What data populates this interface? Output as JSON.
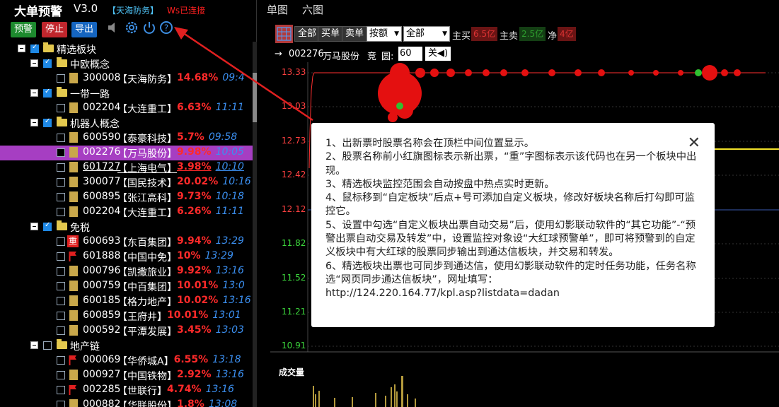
{
  "app": {
    "title": "大单预警",
    "version": "V3.0",
    "tag": "【天海防务】",
    "ws_status": "Ws已连接"
  },
  "toolbar_left": {
    "alert": "预警",
    "stop": "停止",
    "export": "导出"
  },
  "icons": [
    "speaker-icon",
    "gear-icon",
    "power-icon",
    "help-icon"
  ],
  "tree": {
    "root": "精选板块",
    "rows": [
      {
        "kind": "group",
        "level": 1,
        "label": "中欧概念",
        "checked": true
      },
      {
        "kind": "stock",
        "code": "300008",
        "name": "【天海防务】",
        "pct": "14.68%",
        "time": "09:4",
        "icon": "doc"
      },
      {
        "kind": "group",
        "level": 1,
        "label": "一带一路",
        "checked": true
      },
      {
        "kind": "stock",
        "code": "002204",
        "name": "【大连重工】",
        "pct": "6.63%",
        "time": "11:11",
        "icon": "doc"
      },
      {
        "kind": "group",
        "level": 1,
        "label": "机器人概念",
        "checked": true
      },
      {
        "kind": "stock",
        "code": "600590",
        "name": "【泰豪科技】",
        "pct": "5.7%",
        "time": "09:58",
        "icon": "doc"
      },
      {
        "kind": "stock",
        "code": "002276",
        "name": "【万马股份】",
        "pct": "9.98%",
        "time": "10:05",
        "icon": "doc",
        "selected": true
      },
      {
        "kind": "stock",
        "code": "601727",
        "name": "【上海电气】",
        "pct": "3.98%",
        "time": "10:10",
        "icon": "doc",
        "underline": true
      },
      {
        "kind": "stock",
        "code": "300077",
        "name": "【国民技术】",
        "pct": "20.02%",
        "time": "10:16",
        "icon": "doc"
      },
      {
        "kind": "stock",
        "code": "600895",
        "name": "【张江高科】",
        "pct": "9.73%",
        "time": "10:18",
        "icon": "doc"
      },
      {
        "kind": "stock",
        "code": "002204",
        "name": "【大连重工】",
        "pct": "6.26%",
        "time": "11:11",
        "icon": "doc"
      },
      {
        "kind": "group",
        "level": 1,
        "label": "免税",
        "checked": true
      },
      {
        "kind": "stock",
        "code": "600693",
        "name": "【东百集团】",
        "pct": "9.94%",
        "time": "13:29",
        "icon": "zhong"
      },
      {
        "kind": "stock",
        "code": "601888",
        "name": "【中国中免】",
        "pct": "10%",
        "time": "13:29",
        "icon": "flag"
      },
      {
        "kind": "stock",
        "code": "000796",
        "name": "【凯撒旅业】",
        "pct": "9.92%",
        "time": "13:16",
        "icon": "doc"
      },
      {
        "kind": "stock",
        "code": "000759",
        "name": "【中百集团】",
        "pct": "10.01%",
        "time": "13:0",
        "icon": "doc"
      },
      {
        "kind": "stock",
        "code": "600185",
        "name": "【格力地产】",
        "pct": "10.02%",
        "time": "13:16",
        "icon": "doc"
      },
      {
        "kind": "stock",
        "code": "600859",
        "name": "【王府井】",
        "pct": "10.01%",
        "time": "13:01",
        "icon": "doc"
      },
      {
        "kind": "stock",
        "code": "000592",
        "name": "【平潭发展】",
        "pct": "3.45%",
        "time": "13:03",
        "icon": "doc"
      },
      {
        "kind": "group",
        "level": 1,
        "label": "地产链",
        "checked": false
      },
      {
        "kind": "stock",
        "code": "000069",
        "name": "【华侨城A】",
        "pct": "6.55%",
        "time": "13:18",
        "icon": "flag"
      },
      {
        "kind": "stock",
        "code": "000927",
        "name": "【中国铁物】",
        "pct": "2.92%",
        "time": "13:16",
        "icon": "doc"
      },
      {
        "kind": "stock",
        "code": "002285",
        "name": "【世联行】",
        "pct": "4.74%",
        "time": "13:16",
        "icon": "flag"
      },
      {
        "kind": "stock",
        "code": "000882",
        "name": "【华联股份】",
        "pct": "1.8%",
        "time": "13:08",
        "icon": "doc"
      }
    ]
  },
  "tabs": {
    "single": "单图",
    "six": "六图"
  },
  "chart_toolbar": {
    "all1": "全部",
    "buy": "买单",
    "sell": "卖单",
    "sort": "按额",
    "filter": "全部",
    "main_buy_label": "主买",
    "main_buy_value": "6.5亿",
    "main_sell_label": "主卖",
    "main_sell_value": "2.5亿",
    "net_label": "净",
    "net_value": "4亿",
    "colors": {
      "buy": "#c62828",
      "sell": "#2e7d32",
      "net": "#c62828"
    }
  },
  "stock_bar": {
    "arrow": "→",
    "code": "002276",
    "name": "万马股份",
    "auction": "竞",
    "circle_label": "圆:",
    "circle_value": "60",
    "sound": "关◀)"
  },
  "chart": {
    "y_ticks": [
      "13.33",
      "13.03",
      "12.73",
      "12.42",
      "12.12",
      "11.82",
      "11.52",
      "11.21",
      "10.91"
    ],
    "volume_label": "成交量"
  },
  "popup": {
    "lines": [
      "1、出新票时股票名称会在顶栏中间位置显示。",
      "2、股票名称前小红旗图标表示新出票，“重”字图标表示该代码也在另一个板块中出现。",
      "3、精选板块监控范围会自动按盘中热点实时更新。",
      "4、鼠标移到“自定板块”后点+号可添加自定义板块，修改好板块名称后打勾即可监控它。",
      "5、设置中勾选“自定义板块出票自动交易”后，使用幻影联动软件的“其它功能”-“预警出票自动交易及转发”中，设置监控对象设“大红球预警单”，即可将预警到的自定义板块中有大红球的股票同步输出到通达信板块，并交易和转发。",
      "6、精选板块出票也可同步到通达信，使用幻影联动软件的定时任务功能，任务名称选“网页同步通达信板块”，网址填写：",
      "http://124.220.164.77/kpl.asp?listdata=dadan"
    ]
  }
}
